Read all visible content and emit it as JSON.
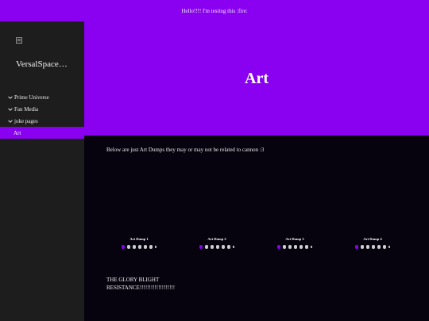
{
  "announcement": {
    "text": "Hello!!!! I'm testing this :fire:"
  },
  "sidebar": {
    "logo_icon": "broken-image-icon",
    "site_title": "VersalSpace…",
    "nav": [
      {
        "label": "Prime Universe",
        "icon": "chevron-down-icon"
      },
      {
        "label": "Fan Media",
        "icon": "chevron-down-icon"
      },
      {
        "label": "joke pages",
        "icon": "chevron-down-icon"
      },
      {
        "label": "Art",
        "active": true
      }
    ]
  },
  "hero": {
    "title": "Art"
  },
  "main": {
    "intro": "Below are just Art Dumps they may or may not be related to cannon :3",
    "galleries": [
      {
        "label": "Art Dump 1"
      },
      {
        "label": "Art Dump 2"
      },
      {
        "label": "Art Dump 3"
      },
      {
        "label": "Art Dump 4"
      }
    ],
    "footer_text": "THE GLORY BLIGHT RESISTANCE!!!!!!!!!!!!!!!!!!!"
  },
  "colors": {
    "accent": "#8a00f0",
    "sidebar_bg": "#1d1d1d",
    "content_bg": "#06030e"
  }
}
